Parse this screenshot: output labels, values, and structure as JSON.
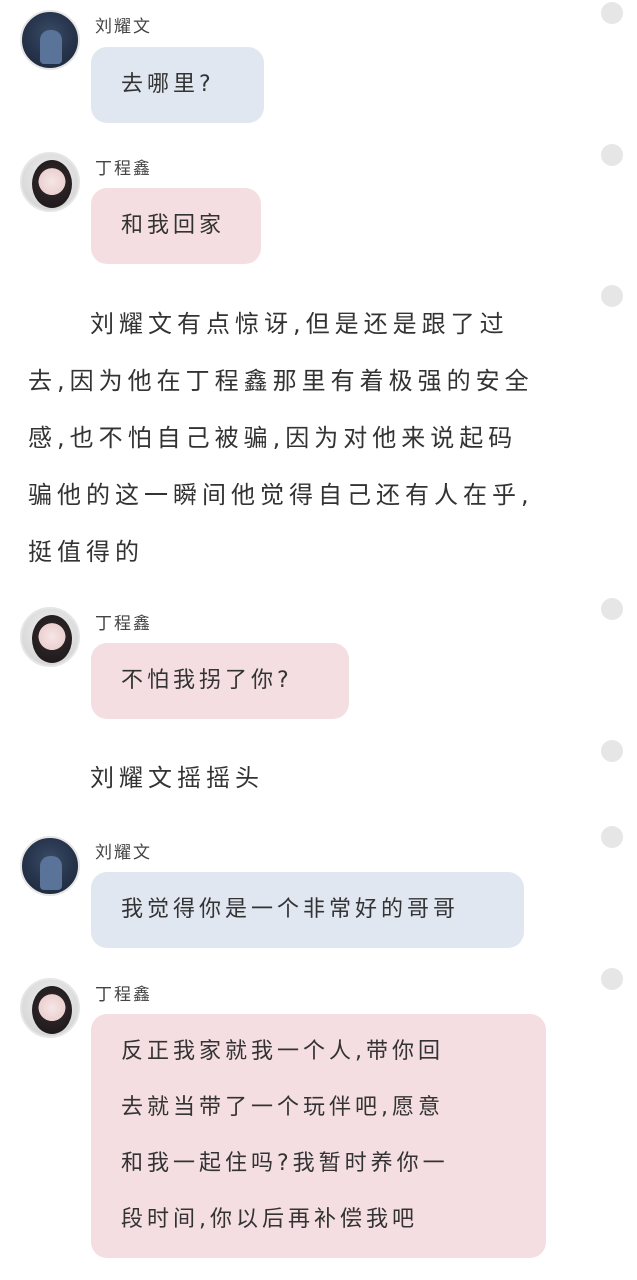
{
  "messages": [
    {
      "speaker": "刘耀文",
      "text": "去哪里?"
    },
    {
      "speaker": "丁程鑫",
      "text": "和我回家"
    },
    {
      "narration": [
        "刘耀文有点惊讶,但是还是跟了过",
        "去,因为他在丁程鑫那里有着极强的安全",
        "感,也不怕自己被骗,因为对他来说起码",
        "骗他的这一瞬间他觉得自己还有人在乎,",
        "挺值得的"
      ]
    },
    {
      "speaker": "丁程鑫",
      "text": "不怕我拐了你?"
    },
    {
      "narration2": "刘耀文摇摇头"
    },
    {
      "speaker": "刘耀文",
      "text": "我觉得你是一个非常好的哥哥"
    },
    {
      "speaker": "丁程鑫",
      "lines": [
        "反正我家就我一个人,带你回",
        "去就当带了一个玩伴吧,愿意",
        "和我一起住吗?我暂时养你一",
        "段时间,你以后再补偿我吧"
      ]
    }
  ],
  "colors": {
    "blue_bubble": "#e1e7f1",
    "pink_bubble": "#f4dee2"
  }
}
